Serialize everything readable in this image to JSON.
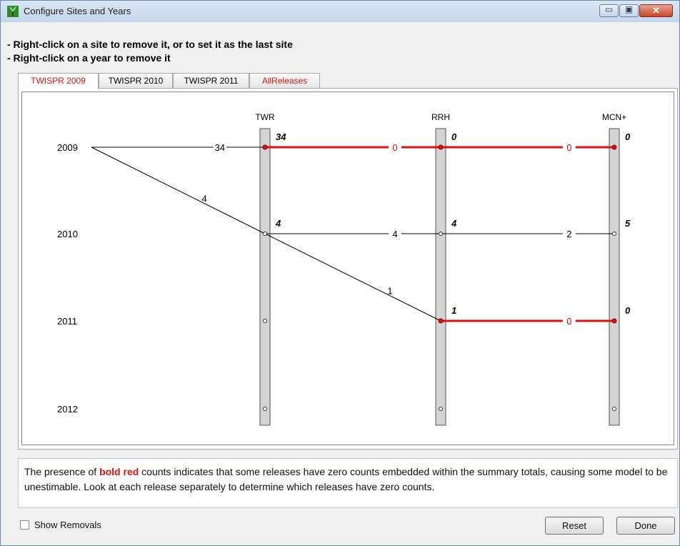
{
  "window": {
    "title": "Configure Sites and Years",
    "minimize_glyph": "▭",
    "maximize_glyph": "▣",
    "close_glyph": "✕"
  },
  "instructions": [
    "- Right-click on a site to remove it, or to set it as the last site",
    "- Right-click on a year to remove it"
  ],
  "tabs": [
    {
      "label": "TWISPR 2009",
      "active": true,
      "color": "#e01010"
    },
    {
      "label": "TWISPR 2010",
      "active": false,
      "color": "#000000"
    },
    {
      "label": "TWISPR 2011",
      "active": false,
      "color": "#000000"
    },
    {
      "label": "AllReleases",
      "active": false,
      "color": "#e01010"
    }
  ],
  "diagram": {
    "sites": [
      "TWR",
      "RRH",
      "MCN+"
    ],
    "years": [
      "2009",
      "2010",
      "2011",
      "2012"
    ],
    "colors": {
      "normal": "#000000",
      "zero": "#e01010",
      "bar": "#d4d4d4"
    },
    "site_totals": [
      {
        "site": "TWR",
        "year": "2009",
        "value": "34"
      },
      {
        "site": "RRH",
        "year": "2009",
        "value": "0"
      },
      {
        "site": "MCN+",
        "year": "2009",
        "value": "0"
      },
      {
        "site": "TWR",
        "year": "2010",
        "value": "4"
      },
      {
        "site": "RRH",
        "year": "2010",
        "value": "4"
      },
      {
        "site": "MCN+",
        "year": "2010",
        "value": "5"
      },
      {
        "site": "RRH",
        "year": "2011",
        "value": "1"
      },
      {
        "site": "MCN+",
        "year": "2011",
        "value": "0"
      }
    ],
    "edges": [
      {
        "from": "year-2009",
        "to": "TWR-2009",
        "label": "34",
        "zero": false
      },
      {
        "from": "TWR-2009",
        "to": "RRH-2009",
        "label": "0",
        "zero": true
      },
      {
        "from": "RRH-2009",
        "to": "MCN+-2009",
        "label": "0",
        "zero": true
      },
      {
        "from": "year-2009",
        "to": "TWR-2010",
        "label": "4",
        "zero": false
      },
      {
        "from": "TWR-2010",
        "to": "RRH-2010",
        "label": "4",
        "zero": false
      },
      {
        "from": "RRH-2010",
        "to": "MCN+-2010",
        "label": "2",
        "zero": false
      },
      {
        "from": "TWR-2010",
        "to": "RRH-2011",
        "label": "1",
        "zero": false
      },
      {
        "from": "RRH-2011",
        "to": "MCN+-2011",
        "label": "0",
        "zero": true
      }
    ]
  },
  "info": {
    "before": "The presence of ",
    "highlight": "bold red",
    "after": " counts indicates that some releases have zero counts embedded within the summary totals, causing some model to be unestimable. Look at each release separately to determine which releases have zero counts."
  },
  "footer": {
    "show_removals_label": "Show Removals",
    "show_removals_checked": false,
    "reset_label": "Reset",
    "done_label": "Done"
  }
}
